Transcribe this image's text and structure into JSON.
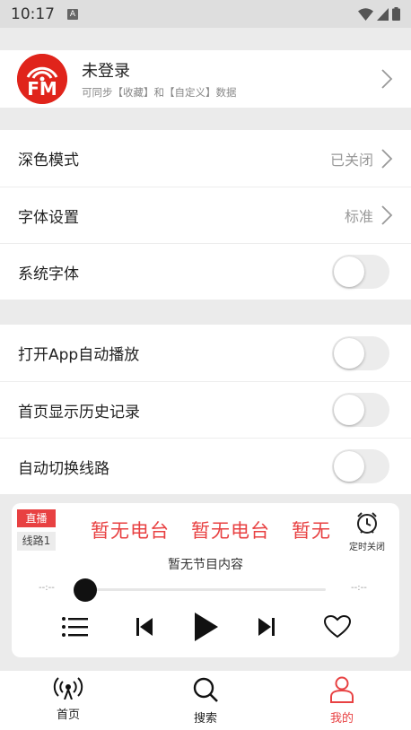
{
  "status_bar": {
    "time": "10:17",
    "badge": "A"
  },
  "profile": {
    "name": "未登录",
    "subtitle": "可同步【收藏】和【自定义】数据",
    "logo_text": "FM"
  },
  "settings": {
    "group1": [
      {
        "label": "深色模式",
        "value": "已关闭"
      },
      {
        "label": "字体设置",
        "value": "标准"
      },
      {
        "label": "系统字体",
        "toggle": false
      }
    ],
    "group2": [
      {
        "label": "打开App自动播放",
        "toggle": false
      },
      {
        "label": "首页显示历史记录",
        "toggle": false
      },
      {
        "label": "自动切换线路",
        "toggle": false
      }
    ]
  },
  "player": {
    "live_badge": "直播",
    "line_badge": "线路1",
    "station_name": "暂无电台",
    "timer_label": "定时关闭",
    "program": "暂无节目内容",
    "elapsed": "--:--",
    "duration": "--:--",
    "progress": 0
  },
  "tabbar": [
    {
      "label": "首页",
      "icon": "radio-icon",
      "active": false
    },
    {
      "label": "搜索",
      "icon": "search-icon",
      "active": false
    },
    {
      "label": "我的",
      "icon": "user-icon",
      "active": true
    }
  ],
  "colors": {
    "accent": "#e84142",
    "background": "#ebebeb"
  }
}
